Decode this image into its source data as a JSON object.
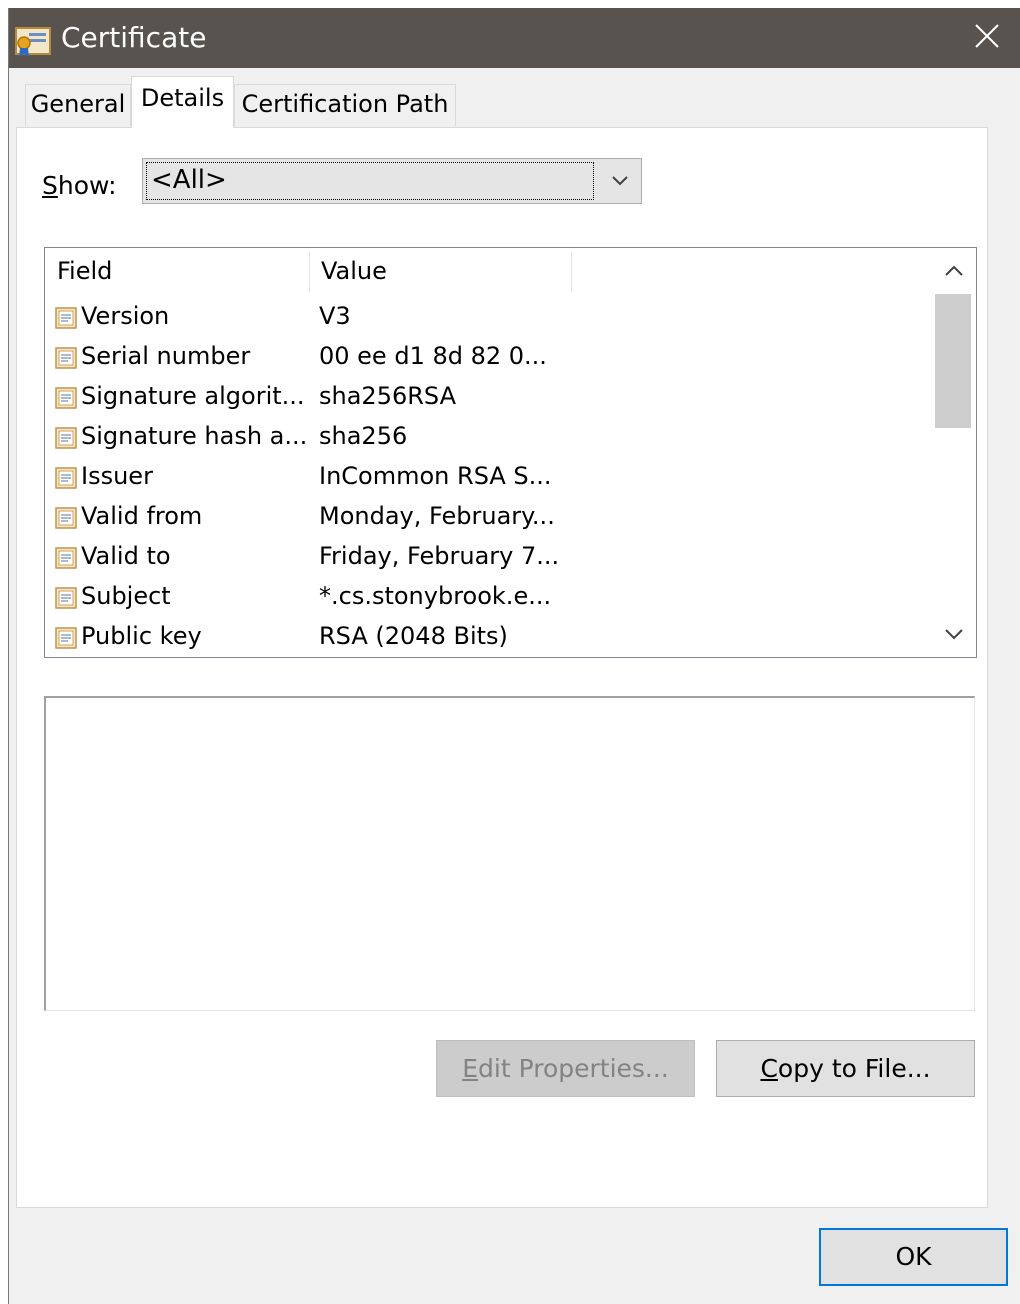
{
  "window": {
    "title": "Certificate",
    "title_icon": "certificate-icon",
    "close_icon": "close-icon"
  },
  "tabs": [
    {
      "label": "General",
      "active": false
    },
    {
      "label": "Details",
      "active": true
    },
    {
      "label": "Certification Path",
      "active": false
    }
  ],
  "show": {
    "label_mnemonic": "S",
    "label_rest": "how:",
    "selected": "<All>",
    "dropdown_icon": "chevron-down-icon"
  },
  "list": {
    "columns": [
      "Field",
      "Value"
    ],
    "rows": [
      {
        "field": "Version",
        "value": "V3"
      },
      {
        "field": "Serial number",
        "value": "00 ee d1 8d 82 0..."
      },
      {
        "field": "Signature algorit...",
        "value": "sha256RSA"
      },
      {
        "field": "Signature hash a...",
        "value": "sha256"
      },
      {
        "field": "Issuer",
        "value": "InCommon RSA S..."
      },
      {
        "field": "Valid from",
        "value": "Monday, February..."
      },
      {
        "field": "Valid to",
        "value": "Friday, February 7..."
      },
      {
        "field": "Subject",
        "value": "*.cs.stonybrook.e..."
      },
      {
        "field": "Public key",
        "value": "RSA (2048 Bits)"
      }
    ],
    "row_icon": "certificate-field-icon",
    "scroll_up_icon": "chevron-up-icon",
    "scroll_down_icon": "chevron-down-icon"
  },
  "detail_text": "",
  "buttons": {
    "edit_mnemonic": "E",
    "edit_rest": "dit Properties...",
    "edit_enabled": false,
    "copy_mnemonic": "C",
    "copy_rest": "opy to File...",
    "ok": "OK"
  },
  "colors": {
    "titlebar": "#58534f",
    "focus_border": "#0078d7",
    "disabled_button": "#cccccc"
  }
}
